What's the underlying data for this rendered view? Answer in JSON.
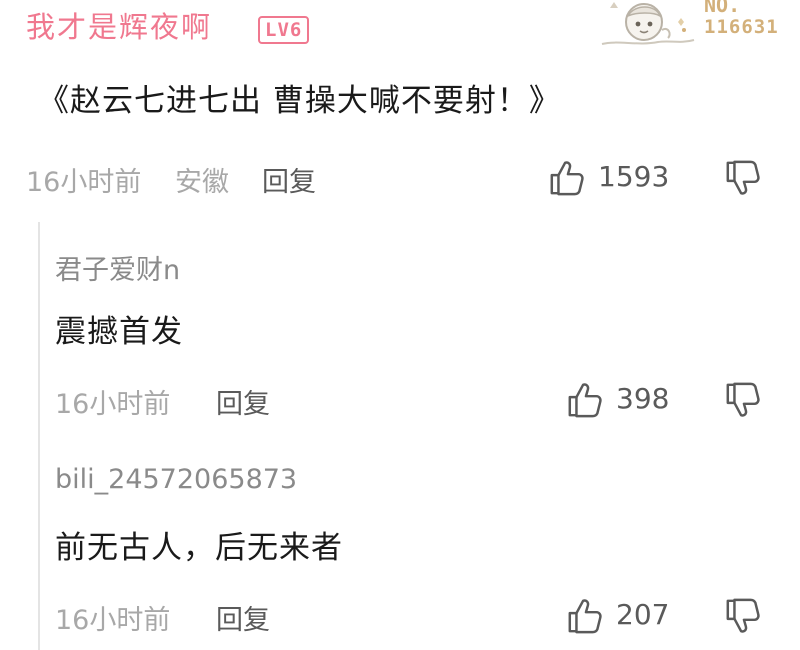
{
  "main_comment": {
    "username": "我才是辉夜啊",
    "level": "LV6",
    "fan_number": {
      "label": "NO.",
      "value": "116631"
    },
    "content": "《赵云七进七出 曹操大喊不要射！》",
    "time": "16小时前",
    "location": "安徽",
    "reply_label": "回复",
    "likes": "1593"
  },
  "replies": [
    {
      "username": "君子爱财n",
      "content": "震撼首发",
      "time": "16小时前",
      "reply_label": "回复",
      "likes": "398"
    },
    {
      "username": "bili_24572065873",
      "content": "前无古人，后无来者",
      "time": "16小时前",
      "reply_label": "回复",
      "likes": "207"
    }
  ],
  "colors": {
    "username_pink": "#f0788f",
    "fan_number_gold": "#d3b07a",
    "meta_gray": "#a8a8a8",
    "action_gray": "#5a5a5a",
    "text_dark": "#1a1a1a"
  },
  "icons": {
    "like": "thumbs-up-icon",
    "dislike": "thumbs-down-icon",
    "avatar_frame": "anime-character-avatar-frame"
  }
}
